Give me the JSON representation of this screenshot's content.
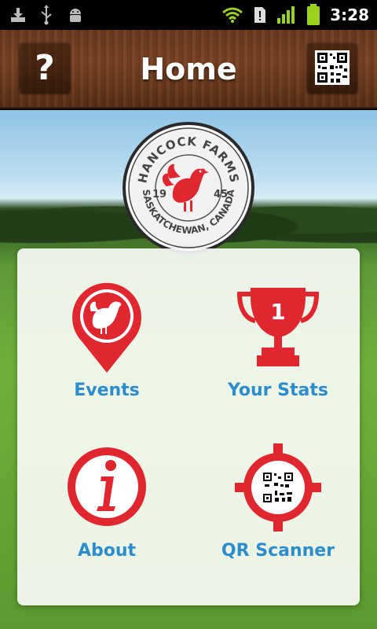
{
  "status_bar": {
    "time": "3:28",
    "icons": [
      "download-icon",
      "usb-icon",
      "android-debug-icon",
      "wifi-icon",
      "sim-alert-icon",
      "signal-icon",
      "battery-icon"
    ]
  },
  "header": {
    "title": "Home",
    "help_label": "?",
    "qr_icon": "qr-code-icon"
  },
  "logo": {
    "brand": "HANCOCK FARMS",
    "year_left": "19",
    "year_right": "45",
    "location": "SASKATCHEWAN, CANADA"
  },
  "menu": {
    "items": [
      {
        "label": "Events",
        "icon": "rooster-pin-icon"
      },
      {
        "label": "Your Stats",
        "icon": "trophy-icon"
      },
      {
        "label": "About",
        "icon": "info-icon"
      },
      {
        "label": "QR Scanner",
        "icon": "qr-target-icon"
      }
    ]
  },
  "colors": {
    "accent_red": "#e0262f",
    "label_blue": "#2d8dcc",
    "wood": "#6b3a1e"
  }
}
